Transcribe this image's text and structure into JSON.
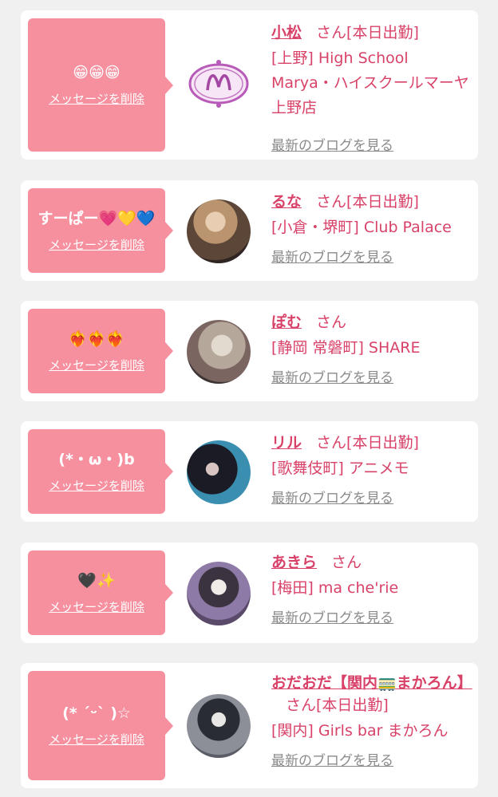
{
  "colors": {
    "accent": "#d94268",
    "bubble": "#f6909f",
    "background": "#f0f0f0",
    "card": "#ffffff",
    "blog_link": "#8a8a8a"
  },
  "delete_label": "メッセージを削除",
  "blog_label": "最新のブログを見る",
  "san_label": "さん",
  "items": [
    {
      "bubble_text": "😁😁😁",
      "name": "小松",
      "status": "[本日出勤]",
      "shop": "[上野] High School Marya・ハイスクールマーヤ上野店",
      "avatar": "shop-logo"
    },
    {
      "bubble_text": "すーぱー💗💛💙",
      "name": "るな",
      "status": "[本日出勤]",
      "shop": "[小倉・堺町] Club Palace",
      "avatar": "photo-blonde-woman"
    },
    {
      "bubble_text": "❤️‍🔥❤️‍🔥❤️‍🔥",
      "name": "ぽむ",
      "status": "",
      "shop": "[静岡 常磐町] SHARE",
      "avatar": "photo-silver-hair"
    },
    {
      "bubble_text": "(*・ω・)b",
      "name": "リル",
      "status": "[本日出勤]",
      "shop": "[歌舞伎町] アニメモ",
      "avatar": "photo-dark-hair-blue"
    },
    {
      "bubble_text": "🖤✨",
      "name": "あきら",
      "status": "",
      "shop": "[梅田] ma che'rie",
      "avatar": "photo-mirror-selfie-purple"
    },
    {
      "bubble_text": "(* ˊᵕˋ )☆",
      "name": "おだおだ【関内🚃まかろん】",
      "status": "[本日出勤]",
      "shop": "[関内] Girls bar まかろん",
      "avatar": "photo-mirror-selfie-gray"
    }
  ]
}
